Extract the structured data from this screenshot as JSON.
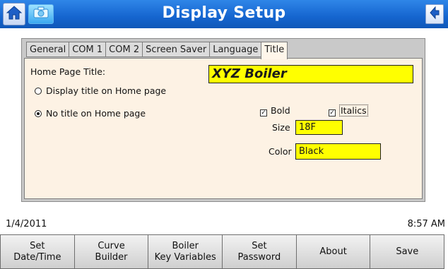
{
  "header": {
    "title": "Display Setup",
    "home_icon": "home-icon",
    "camera_icon": "camera-icon",
    "back_icon": "back-arrow-icon"
  },
  "tabs": [
    {
      "label": "General",
      "active": false
    },
    {
      "label": "COM 1",
      "active": false
    },
    {
      "label": "COM 2",
      "active": false
    },
    {
      "label": "Screen Saver",
      "active": false
    },
    {
      "label": "Language",
      "active": false
    },
    {
      "label": "Title",
      "active": true
    }
  ],
  "title_tab": {
    "home_page_title_label": "Home Page Title:",
    "home_page_title_value": "XYZ Boiler",
    "radio_display": {
      "label": "Display title on Home page",
      "selected": false
    },
    "radio_no_title": {
      "label": "No title on Home page",
      "selected": true
    },
    "bold": {
      "label": "Bold",
      "checked": true
    },
    "italics": {
      "label": "Italics",
      "checked": true
    },
    "size_label": "Size",
    "size_value": "18F",
    "color_label": "Color",
    "color_value": "Black"
  },
  "status": {
    "date": "1/4/2011",
    "time": "8:57 AM"
  },
  "bottom_buttons": [
    "Set\nDate/Time",
    "Curve\nBuilder",
    "Boiler\nKey Variables",
    "Set\nPassword",
    "About",
    "Save"
  ],
  "colors": {
    "header_blue": "#1565cf",
    "field_yellow": "#ffff00",
    "panel_bg": "#fdf2e4"
  }
}
